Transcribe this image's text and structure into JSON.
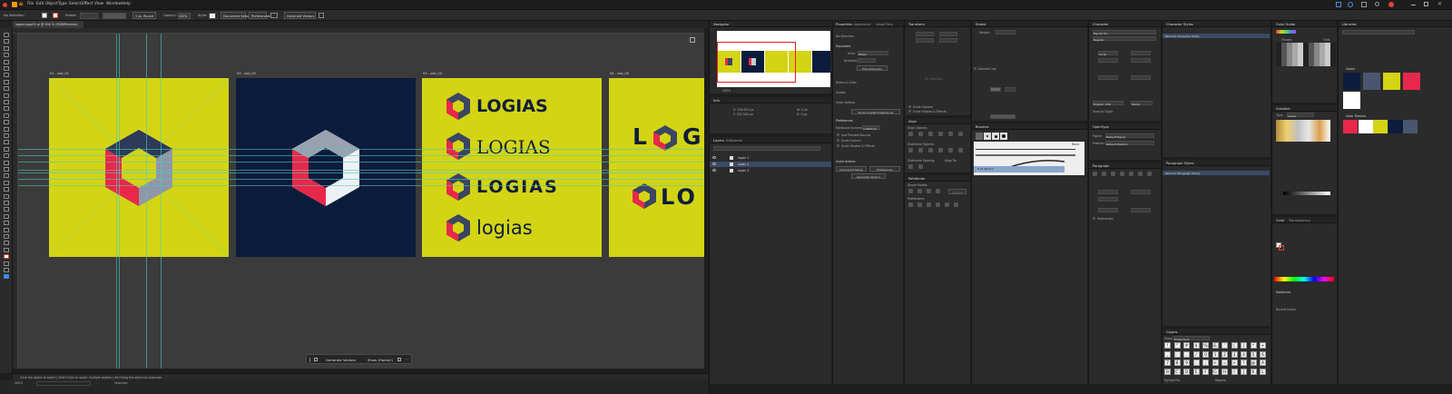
{
  "app": {
    "name": "Ai"
  },
  "menu": [
    "File",
    "Edit",
    "Object",
    "Type",
    "Select",
    "Effect",
    "View",
    "Window",
    "Help"
  ],
  "control_bar": {
    "selection": "No Selection",
    "stroke_label": "Stroke:",
    "stroke_weight": "5 pt. Round",
    "opacity_label": "Opacity:",
    "opacity_value": "100%",
    "style_label": "Style:",
    "document_setup": "Document Setup",
    "preferences": "Preferences",
    "generate_vectors": "Generate Vectors"
  },
  "document_tab": {
    "title": "logias-logo02.ai @ 300 % (RGB/Preview)"
  },
  "artboards": [
    {
      "label": "01 - sub_01",
      "bg": "#d3d414"
    },
    {
      "label": "02 - sub_02",
      "bg": "#0c1c3c"
    },
    {
      "label": "03 - sub_03",
      "bg": "#d3d414"
    },
    {
      "label": "04 - sub_04",
      "bg": "#d3d414"
    }
  ],
  "wordmarks": [
    "LOGIAS",
    "LOGIAS",
    "LOGIAS",
    "logias"
  ],
  "partial_wordmark_a": "L",
  "partial_wordmark_b": "G",
  "partial_wordmark_c": "LO",
  "floating_bar": {
    "generate": "Generate Vectors",
    "show": "Show (Home2)"
  },
  "status": {
    "hint": "Click the object to select  |  Shift+Click to select multiple objects  |  Alt+Drag the object to duplicate",
    "zoom": "300%",
    "mode": "Selection"
  },
  "navigator": {
    "title": "Navigator",
    "zoom": "100%"
  },
  "info": {
    "title": "Info",
    "x": "X: 238.953 px",
    "y": "Y: 202.004 px",
    "w": "W: 0 px",
    "h": "H: 0 px"
  },
  "layers": {
    "title": "Layers",
    "tab2": "Artboards",
    "items": [
      "Layer 1",
      "Layer 2",
      "Layer 3"
    ]
  },
  "properties": {
    "title": "Properties",
    "tab2": "Appearance",
    "tab3": "Image Trace",
    "no_selection": "No Selection",
    "document": "Document",
    "units_label": "Units:",
    "units": "Pixels",
    "artboard_label": "Artboard:",
    "edit_artboards": "Edit Artboards",
    "rulers_grids": "Rulers & Grids",
    "guides": "Guides",
    "snap_options": "Snap Options",
    "smart_guides_btn": "Smart Guides Preferences",
    "preferences": "Preferences",
    "keyboard_label": "Keyboard Increment:",
    "keyboard_value": "1.0000 px",
    "preview_bounds": "Use Preview Bounds",
    "scale_corners": "Scale Corners",
    "scale_strokes": "Scale Strokes & Effects",
    "quick_actions": "Quick Actions",
    "document_setup": "Document Setup",
    "prefs_btn": "Preferences",
    "generate_vectors": "Generate Vectors"
  },
  "transform": {
    "title": "Transform",
    "no_selection": "No Selection",
    "scale_corners": "Scale Corners",
    "scale_strokes": "Scale Strokes & Effects"
  },
  "align": {
    "title": "Align",
    "align_objects": "Align Objects:",
    "distribute_objects": "Distribute Objects:",
    "distribute_spacing": "Distribute Spacing:",
    "align_to": "Align To:"
  },
  "pathfinder": {
    "title": "Pathfinder",
    "shape_modes": "Shape Modes:",
    "pathfinders": "Pathfinders:",
    "expand": "Expand"
  },
  "stroke": {
    "title": "Stroke",
    "weight": "Weight:",
    "dashed": "Dashed Line"
  },
  "brushes": {
    "title": "Brushes",
    "basic": "Basic",
    "label": "5 pt. Round"
  },
  "character": {
    "title": "Character",
    "font": "Myriad Pro",
    "style": "Regular",
    "size": "12 pt",
    "lang": "English: USA",
    "sharp": "Sharp",
    "snap": "Snap to Glyph"
  },
  "opentype": {
    "title": "OpenType",
    "figure": "Figure:",
    "figure_val": "Default Figure",
    "position": "Position:",
    "position_val": "Default Position"
  },
  "paragraph": {
    "title": "Paragraph",
    "hyphenate": "Hyphenate"
  },
  "char_styles": {
    "title": "Character Styles",
    "item": "[Normal Character Style]"
  },
  "para_styles": {
    "title": "Paragraph Styles",
    "item": "[Normal Paragraph Style]"
  },
  "glyphs": {
    "title": "Glyphs",
    "show": "Show:",
    "show_val": "Entire Font",
    "font": "Myriad Pro",
    "style": "Regular",
    "row1": [
      "!",
      "\"",
      "#",
      "$",
      "%",
      "&",
      "'",
      "(",
      ")",
      "*",
      "+"
    ],
    "row2": [
      ",",
      "-",
      ".",
      "/",
      "0",
      "1",
      "2",
      "3",
      "4",
      "5",
      "6"
    ],
    "row3": [
      "7",
      "8",
      "9",
      ":",
      ";",
      "<",
      "=",
      ">",
      "?",
      "@",
      "A"
    ],
    "row4": [
      "B",
      "C",
      "D",
      "E",
      "F",
      "G",
      "H",
      "I",
      "J",
      "K",
      "L"
    ]
  },
  "color_guide": {
    "title": "Color Guide",
    "shades": "Shades",
    "tints": "Tints"
  },
  "swatches_panel": {
    "title": "Swatches",
    "themes": "Themes",
    "name_label": "Name",
    "gradient": "Gradient",
    "type": "Type:",
    "type_val": "Linear"
  },
  "color": {
    "title": "Color",
    "tab2": "Transparency",
    "recent": "Recent Colors",
    "tab3": "Swatches"
  },
  "right_lib": {
    "title": "Libraries",
    "colors": "Colors",
    "color_themes": "Color Themes",
    "swatches": [
      "#0c1c3c",
      "#4a5670",
      "#d3d414",
      "#e8284a",
      "#ffffff"
    ],
    "theme": [
      "#e8284a",
      "#ffffff",
      "#d3d414",
      "#0c1c3c",
      "#4a5670"
    ]
  },
  "colors": {
    "yellow": "#d3d414",
    "navy": "#0c1c3c",
    "red": "#e8284a",
    "guide": "#4ec9c0",
    "accent": "#4a8fe0"
  }
}
